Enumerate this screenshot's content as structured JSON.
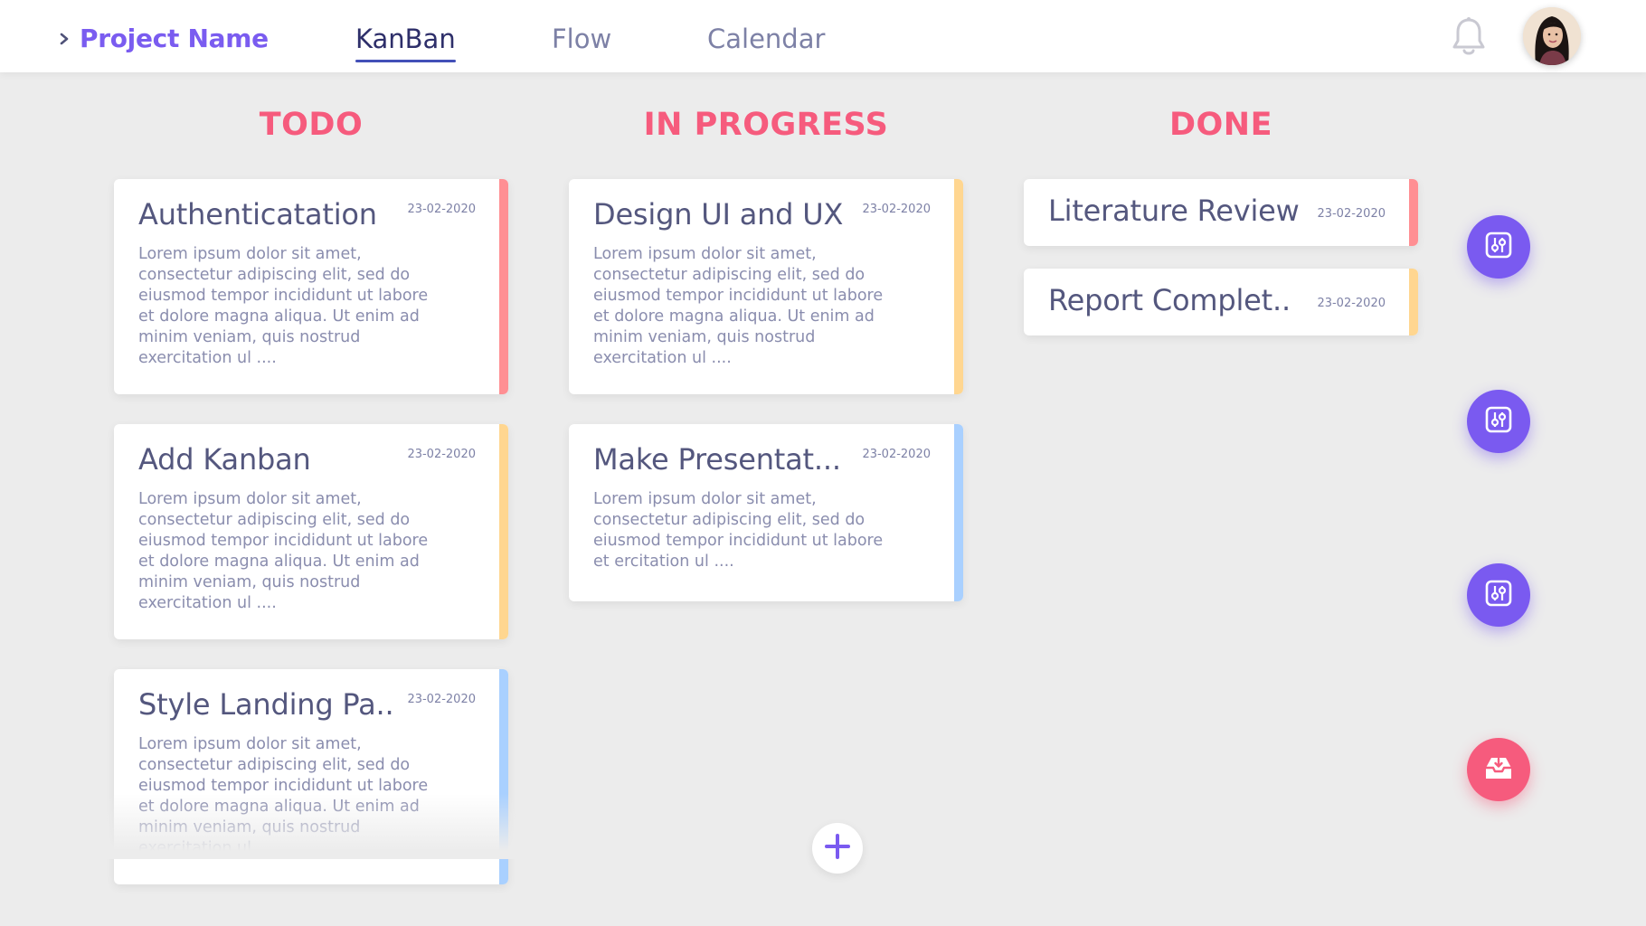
{
  "header": {
    "project_name": "Project Name",
    "tabs": [
      {
        "label": "KanBan",
        "active": true
      },
      {
        "label": "Flow",
        "active": false
      },
      {
        "label": "Calendar",
        "active": false
      }
    ],
    "icons": {
      "expand": "chevron-right-icon",
      "notifications": "bell-icon",
      "profile": "avatar"
    }
  },
  "columns": [
    {
      "title": "TODO",
      "cards": [
        {
          "title": "Authenticatation",
          "date": "23-02-2020",
          "accent": "#ff8f93",
          "body": "Lorem ipsum dolor sit amet, consectetur adipiscing elit, sed do eiusmod tempor incididunt ut labore et dolore magna aliqua. Ut enim ad minim veniam, quis nostrud exercitation ul ...."
        },
        {
          "title": "Add Kanban",
          "date": "23-02-2020",
          "accent": "#ffd690",
          "body": "Lorem ipsum dolor sit amet, consectetur adipiscing elit, sed do eiusmod tempor incididunt ut labore et dolore magna aliqua. Ut enim ad minim veniam, quis nostrud exercitation ul ...."
        },
        {
          "title": "Style Landing Pa..",
          "date": "23-02-2020",
          "accent": "#a9d0ff",
          "body": "Lorem ipsum dolor sit amet, consectetur adipiscing elit, sed do eiusmod tempor incididunt ut labore et dolore magna aliqua. Ut enim ad minim veniam, quis nostrud exercitation ul ...."
        }
      ]
    },
    {
      "title": "IN PROGRESS",
      "cards": [
        {
          "title": "Design UI and UX",
          "date": "23-02-2020",
          "accent": "#ffd690",
          "body": "Lorem ipsum dolor sit amet, consectetur adipiscing elit, sed do eiusmod tempor incididunt ut labore et dolore magna aliqua. Ut enim ad minim veniam, quis nostrud exercitation ul ...."
        },
        {
          "title": "Make Presentat...",
          "date": "23-02-2020",
          "accent": "#a9d0ff",
          "body": "Lorem ipsum dolor sit amet, consectetur adipiscing elit, sed do eiusmod tempor incididunt ut labore et ercitation ul ...."
        }
      ]
    },
    {
      "title": "DONE",
      "cards": [
        {
          "title": "Literature Review",
          "date": "23-02-2020",
          "accent": "#ff8f93"
        },
        {
          "title": "Report Complet..",
          "date": "23-02-2020",
          "accent": "#ffd690"
        }
      ]
    }
  ],
  "actions": {
    "fab_icons": [
      "control-panel-icon",
      "control-panel-icon",
      "control-panel-icon",
      "inbox-icon"
    ],
    "add_icon": "plus-icon"
  },
  "colors": {
    "brand_purple": "#7a5af0",
    "column_title_pink": "#f65b7d",
    "accent_red": "#ff8f93",
    "accent_yellow": "#ffd690",
    "accent_blue": "#a9d0ff",
    "background": "#ececec"
  }
}
